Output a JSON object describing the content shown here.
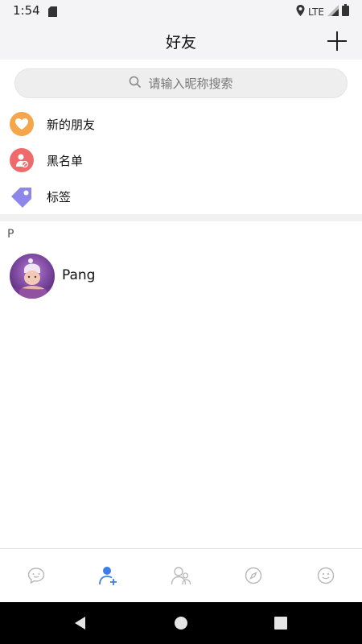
{
  "status_bar": {
    "time": "1:54",
    "network": "LTE"
  },
  "header": {
    "title": "好友",
    "add_icon": "plus-icon"
  },
  "search": {
    "placeholder": "请输入昵称搜索",
    "icon": "search-icon"
  },
  "entries": [
    {
      "label": "新的朋友",
      "icon": "heart-icon",
      "color": "#f5a54a"
    },
    {
      "label": "黑名单",
      "icon": "blocked-user-icon",
      "color": "#ef6b6b"
    },
    {
      "label": "标签",
      "icon": "tag-icon",
      "color": "#8e86e8"
    }
  ],
  "contacts": {
    "section_letter": "P",
    "items": [
      {
        "name": "Pang"
      }
    ]
  },
  "tabs": [
    {
      "icon": "chat-bubble-icon",
      "active": false
    },
    {
      "icon": "friends-add-icon",
      "active": true
    },
    {
      "icon": "groups-icon",
      "active": false
    },
    {
      "icon": "compass-icon",
      "active": false
    },
    {
      "icon": "smile-icon",
      "active": false
    }
  ],
  "colors": {
    "accent": "#3a7fe8",
    "inactive": "#b8b8b8"
  }
}
